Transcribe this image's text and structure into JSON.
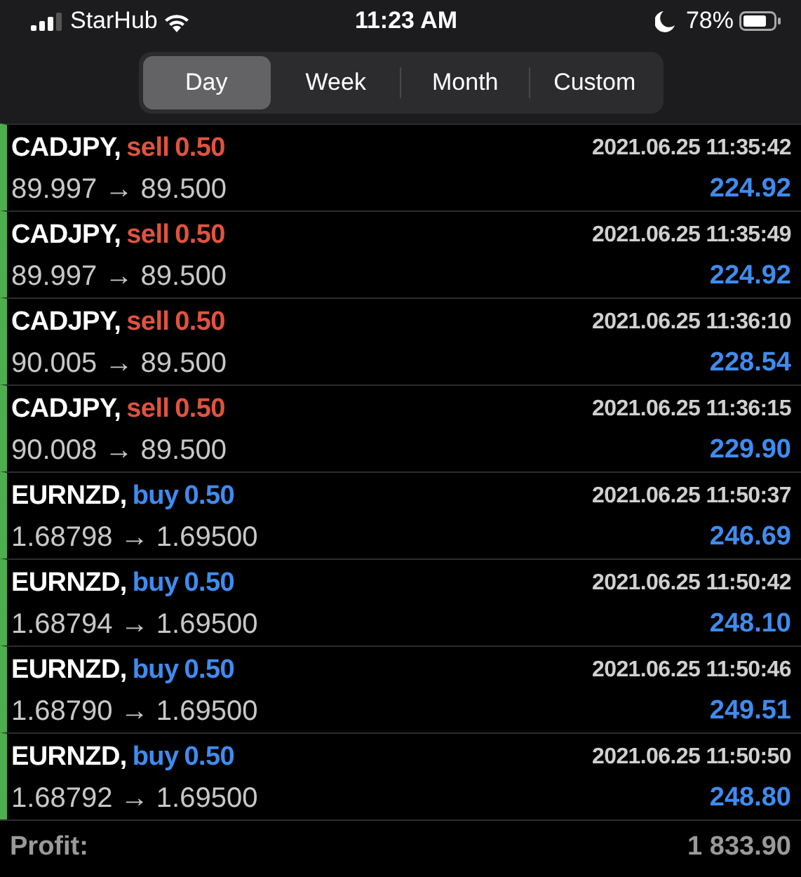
{
  "status_bar": {
    "carrier": "StarHub",
    "time": "11:23 AM",
    "battery": "78%"
  },
  "tabs": [
    {
      "label": "Day",
      "selected": true
    },
    {
      "label": "Week",
      "selected": false
    },
    {
      "label": "Month",
      "selected": false
    },
    {
      "label": "Custom",
      "selected": false
    }
  ],
  "deals": [
    {
      "symbol": "CADJPY,",
      "side": "sell",
      "volume": "0.50",
      "prices": "89.997 → 89.500",
      "time": "2021.06.25 11:35:42",
      "profit": "224.92"
    },
    {
      "symbol": "CADJPY,",
      "side": "sell",
      "volume": "0.50",
      "prices": "89.997 → 89.500",
      "time": "2021.06.25 11:35:49",
      "profit": "224.92"
    },
    {
      "symbol": "CADJPY,",
      "side": "sell",
      "volume": "0.50",
      "prices": "90.005 → 89.500",
      "time": "2021.06.25 11:36:10",
      "profit": "228.54"
    },
    {
      "symbol": "CADJPY,",
      "side": "sell",
      "volume": "0.50",
      "prices": "90.008 → 89.500",
      "time": "2021.06.25 11:36:15",
      "profit": "229.90"
    },
    {
      "symbol": "EURNZD,",
      "side": "buy",
      "volume": "0.50",
      "prices": "1.68798 → 1.69500",
      "time": "2021.06.25 11:50:37",
      "profit": "246.69"
    },
    {
      "symbol": "EURNZD,",
      "side": "buy",
      "volume": "0.50",
      "prices": "1.68794 → 1.69500",
      "time": "2021.06.25 11:50:42",
      "profit": "248.10"
    },
    {
      "symbol": "EURNZD,",
      "side": "buy",
      "volume": "0.50",
      "prices": "1.68790 → 1.69500",
      "time": "2021.06.25 11:50:46",
      "profit": "249.51"
    },
    {
      "symbol": "EURNZD,",
      "side": "buy",
      "volume": "0.50",
      "prices": "1.68792 → 1.69500",
      "time": "2021.06.25 11:50:50",
      "profit": "248.80"
    }
  ],
  "summary": {
    "label": "Profit:",
    "value": "1 833.90"
  }
}
